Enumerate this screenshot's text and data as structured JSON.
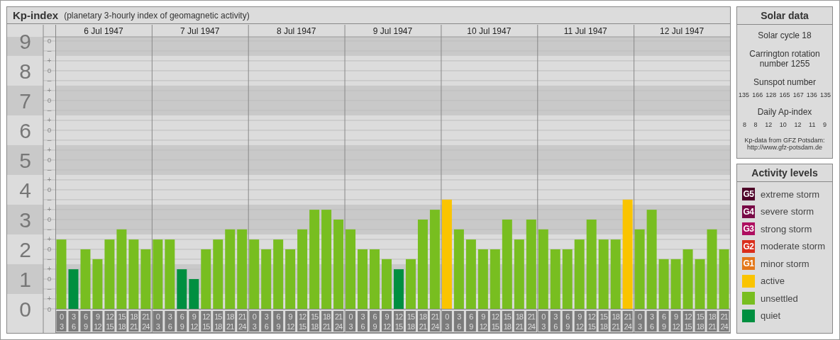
{
  "header": {
    "title": "Kp-index",
    "subtitle": "(planetary 3-hourly index of geomagnetic activity)"
  },
  "chart": {
    "days": [
      {
        "date": "6 Jul 1947"
      },
      {
        "date": "7 Jul 1947"
      },
      {
        "date": "8 Jul 1947"
      },
      {
        "date": "9 Jul 1947"
      },
      {
        "date": "10 Jul 1947"
      },
      {
        "date": "11 Jul 1947"
      },
      {
        "date": "12 Jul 1947"
      }
    ],
    "fraction_marks": [
      {
        "zero": "o",
        "minus": "–"
      },
      {
        "plus": "+",
        "zero": "o",
        "minus": "–"
      },
      {
        "plus": "+",
        "zero": "o",
        "minus": "–"
      },
      {
        "plus": "+",
        "zero": "o",
        "minus": "–"
      },
      {
        "plus": "+",
        "zero": "o",
        "minus": "–"
      },
      {
        "plus": "+",
        "zero": "o",
        "minus": "–"
      },
      {
        "plus": "+",
        "zero": "o",
        "minus": "–"
      },
      {
        "plus": "+",
        "zero": "o",
        "minus": "–"
      },
      {
        "plus": "+",
        "zero": "o",
        "minus": "–"
      },
      {
        "plus": "+",
        "zero": "o"
      }
    ],
    "chart_data": {
      "type": "bar",
      "ylim": [
        0,
        9.14
      ],
      "yticks": [
        0,
        1,
        2,
        3,
        4,
        5,
        6,
        7,
        8,
        9
      ],
      "grid": true,
      "bands": [
        {
          "axis": "y",
          "from": 0.5,
          "to": 1.5
        },
        {
          "axis": "y",
          "from": 2.5,
          "to": 3.5
        },
        {
          "axis": "y",
          "from": 4.5,
          "to": 5.5
        },
        {
          "axis": "y",
          "from": 6.5,
          "to": 7.5
        },
        {
          "axis": "y",
          "from": 8.5,
          "to": 9.14
        }
      ],
      "categories": [
        "0\n3",
        "3\n6",
        "6\n9",
        "9\n12",
        "12\n15",
        "15\n18",
        "18\n21",
        "21\n24",
        "0\n3",
        "3\n6",
        "6\n9",
        "9\n12",
        "12\n15",
        "15\n18",
        "18\n21",
        "21\n24",
        "0\n3",
        "3\n6",
        "6\n9",
        "9\n12",
        "12\n15",
        "15\n18",
        "18\n21",
        "21\n24",
        "0\n3",
        "3\n6",
        "6\n9",
        "9\n12",
        "12\n15",
        "15\n18",
        "18\n21",
        "21\n24",
        "0\n3",
        "3\n6",
        "6\n9",
        "9\n12",
        "12\n15",
        "15\n18",
        "18\n21",
        "21\n24",
        "0\n3",
        "3\n6",
        "6\n9",
        "9\n12",
        "12\n15",
        "15\n18",
        "18\n21",
        "21\n24",
        "0\n3",
        "3\n6",
        "6\n9",
        "9\n12",
        "12\n15",
        "15\n18",
        "18\n21",
        "21\n24"
      ],
      "series": [
        {
          "values": [
            2.33,
            1.33,
            2,
            1.67,
            2.33,
            2.67,
            2.33,
            2,
            2.33,
            2.33,
            1.33,
            1,
            2,
            2.33,
            2.67,
            2.67,
            2.33,
            2,
            2.33,
            2,
            2.67,
            3.33,
            3.33,
            3,
            2.67,
            2,
            2,
            1.67,
            1.33,
            1.67,
            3,
            3.33,
            3.67,
            2.67,
            2.33,
            2,
            2,
            3,
            2.33,
            3,
            2.67,
            2,
            2,
            2.33,
            3,
            2.33,
            2.33,
            3.67,
            2.67,
            3.33,
            1.67,
            1.67,
            2,
            1.67,
            2.67,
            2
          ]
        }
      ]
    }
  },
  "solar_data": {
    "title": "Solar data",
    "cycle": "Solar cycle 18",
    "carrington": "Carrington rotation number 1255",
    "sunspot_label": "Sunspot number",
    "sunspots": [
      "135",
      "166",
      "128",
      "165",
      "167",
      "136",
      "135"
    ],
    "ap_label": "Daily Ap-index",
    "ap_values": [
      "8",
      "8",
      "12",
      "10",
      "12",
      "11",
      "9"
    ],
    "source_label": "Kp-data from GFZ Potsdam:",
    "source_url": "http://www.gfz-potsdam.de"
  },
  "activity_levels": {
    "title": "Activity levels",
    "items": [
      {
        "badge": "G5",
        "label": "extreme storm",
        "color": "#4e0028"
      },
      {
        "badge": "G4",
        "label": "severe storm",
        "color": "#780a46"
      },
      {
        "badge": "G3",
        "label": "strong storm",
        "color": "#ae0e60"
      },
      {
        "badge": "G2",
        "label": "moderate storm",
        "color": "#da2e1c"
      },
      {
        "badge": "G1",
        "label": "minor storm",
        "color": "#e4781a"
      },
      {
        "label": "active",
        "color": "#fac400"
      },
      {
        "label": "unsettled",
        "color": "#78be20"
      },
      {
        "label": "quiet",
        "color": "#008f40"
      }
    ]
  }
}
